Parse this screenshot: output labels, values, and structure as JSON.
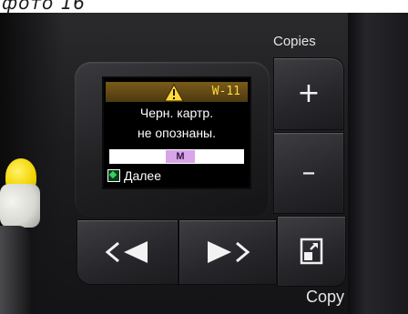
{
  "caption": "фото 16",
  "panel": {
    "copies_label": "Copies",
    "copy_label": "Copy"
  },
  "lcd": {
    "error_code": "W-11",
    "message_line1": "Черн. картр.",
    "message_line2": "не опознаны.",
    "cartridge_label": "M",
    "next_label": "Далее",
    "icons": {
      "warning": "warning-icon",
      "next": "next-diamond-icon"
    }
  },
  "buttons": {
    "plus_label": "+",
    "minus_label": "–",
    "left_icon": "arrow-left-icon",
    "right_icon": "arrow-right-icon",
    "copy_icon": "copy-icon"
  },
  "colors": {
    "warning_yellow": "#ffd93b",
    "cartridge_magenta": "#d7a5e8",
    "next_green": "#37d15a"
  }
}
